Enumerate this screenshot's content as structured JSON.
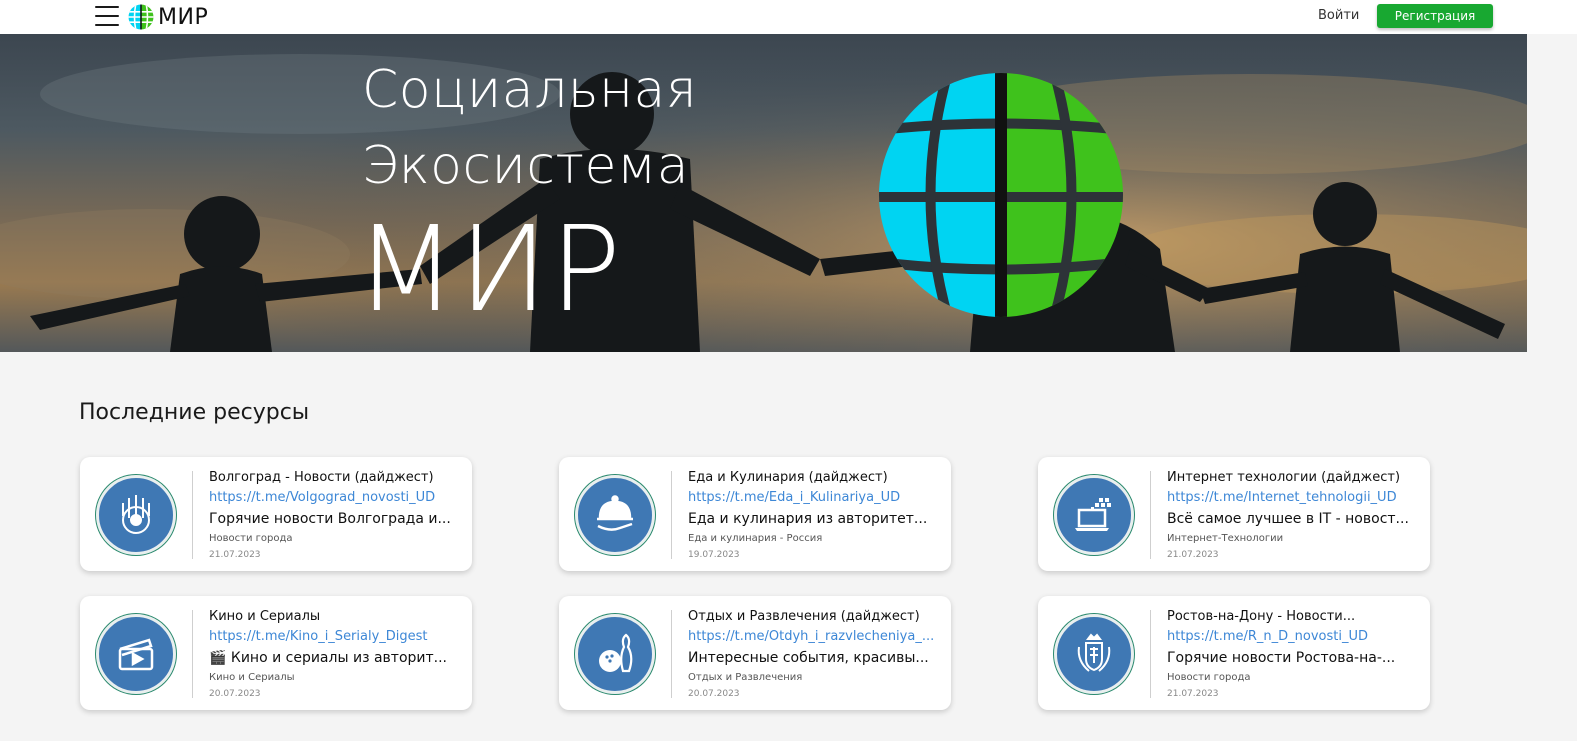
{
  "header": {
    "brand": "МИР",
    "login_label": "Войти",
    "register_label": "Регистрация"
  },
  "hero": {
    "line1": "Социальная",
    "line2": "Экосистема",
    "line3": "МИР"
  },
  "section": {
    "title": "Последние ресурсы"
  },
  "colors": {
    "accent_green": "#18a831",
    "link_blue": "#3d87d6",
    "globe_cyan": "#00d4f2",
    "globe_green": "#3fc21c"
  },
  "cards": [
    {
      "icon": "emblem-icon",
      "title": "Волгоград -  Новости (дайджест)",
      "link": "https://t.me/Volgograd_novosti_UD",
      "description": "Горячие новости  Волгограда и...",
      "category": "Новости города",
      "date": "21.07.2023"
    },
    {
      "icon": "cloche-icon",
      "title": "Еда и  Кулинария (дайджест)",
      "link": "https://t.me/Eda_i_Kulinariya_UD",
      "description": "Еда и кулинария из авторитет...",
      "category": "Еда и кулинария -  Россия",
      "date": "19.07.2023"
    },
    {
      "icon": "laptop-icon",
      "title": "Интернет технологии (дайджест)",
      "link": "https://t.me/Internet_tehnologii_UD",
      "description": "Всё самое лучшее в IT - новост...",
      "category": "Интернет-Технологии",
      "date": "21.07.2023"
    },
    {
      "icon": "clapperboard-icon",
      "title": "Кино и Сериалы",
      "link": "https://t.me/Kino_i_Serialy_Digest",
      "description": "🎬  Кино и сериалы из авторит...",
      "category": "Кино и Сериалы",
      "date": "20.07.2023"
    },
    {
      "icon": "bowling-icon",
      "title": "Отдых и  Развлечения (дайджест)",
      "link": "https://t.me/Otdyh_i_razvlecheniya_...",
      "description": "Интересные события, красивы...",
      "category": "Отдых и  Развлечения",
      "date": "20.07.2023"
    },
    {
      "icon": "coat-of-arms-icon",
      "title": "Ростов-на-Дону -  Новости...",
      "link": "https://t.me/R_n_D_novosti_UD",
      "description": "Горячие новости  Ростова-на-...",
      "category": "Новости города",
      "date": "21.07.2023"
    }
  ]
}
